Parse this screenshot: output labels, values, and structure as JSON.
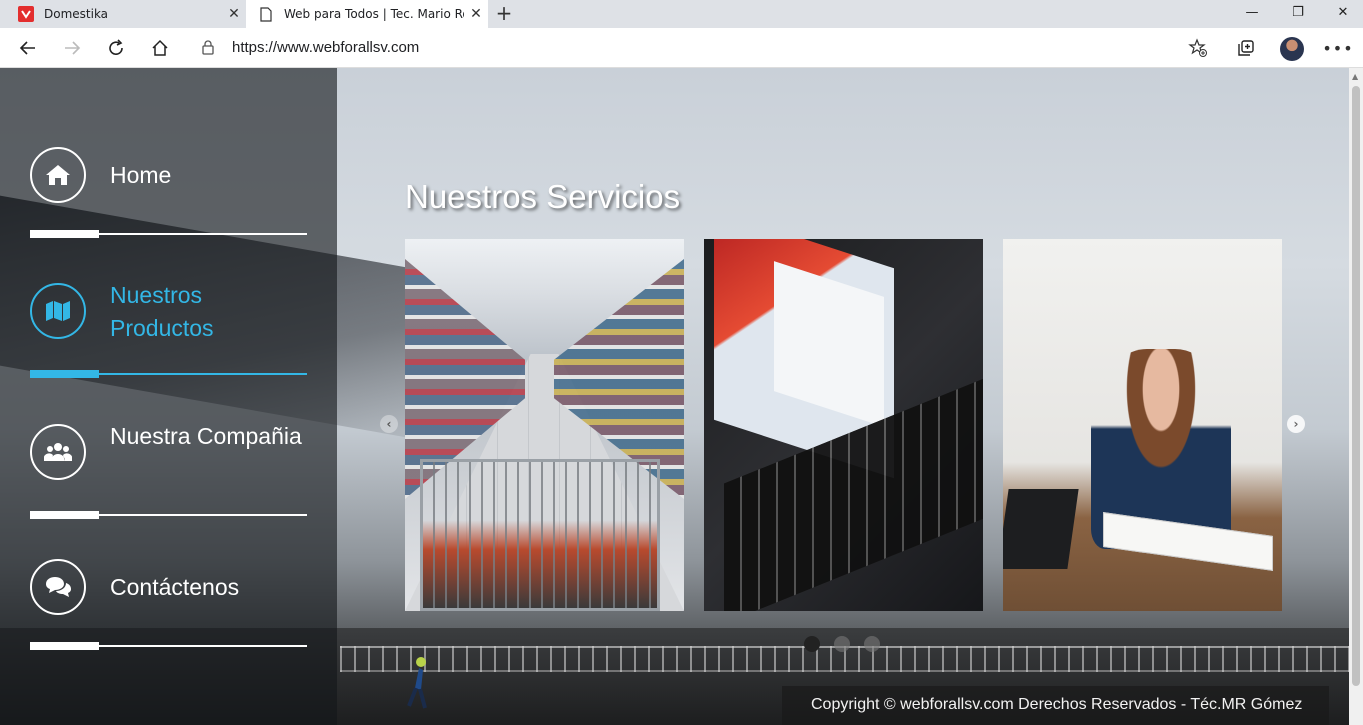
{
  "browser": {
    "tabs": [
      {
        "title": "Domestika",
        "favicon": "domestika-logo-icon",
        "active": false
      },
      {
        "title": "Web para Todos | Tec. Mario Rob",
        "favicon": "page-icon",
        "active": true
      }
    ],
    "url": "https://www.webforallsv.com",
    "accent": "#e32e2e"
  },
  "sidebar": {
    "items": [
      {
        "label": "Home",
        "icon": "home-icon",
        "active": false
      },
      {
        "label": "Nuestros Productos",
        "icon": "map-icon",
        "active": true
      },
      {
        "label": "Nuestra Compañia",
        "icon": "users-icon",
        "active": false
      },
      {
        "label": "Contáctenos",
        "icon": "chat-icon",
        "active": false
      }
    ],
    "active_color": "#33b7e6"
  },
  "services": {
    "title": "Nuestros Servicios",
    "cards": [
      {
        "subject": "supermarket-aisle-photo"
      },
      {
        "subject": "laptop-screen-photo"
      },
      {
        "subject": "woman-with-laptop-photo"
      }
    ],
    "slide_count": 3,
    "active_slide": 1
  },
  "footer": {
    "text": "Copyright © webforallsv.com Derechos Reservados - Téc.MR Gómez"
  }
}
